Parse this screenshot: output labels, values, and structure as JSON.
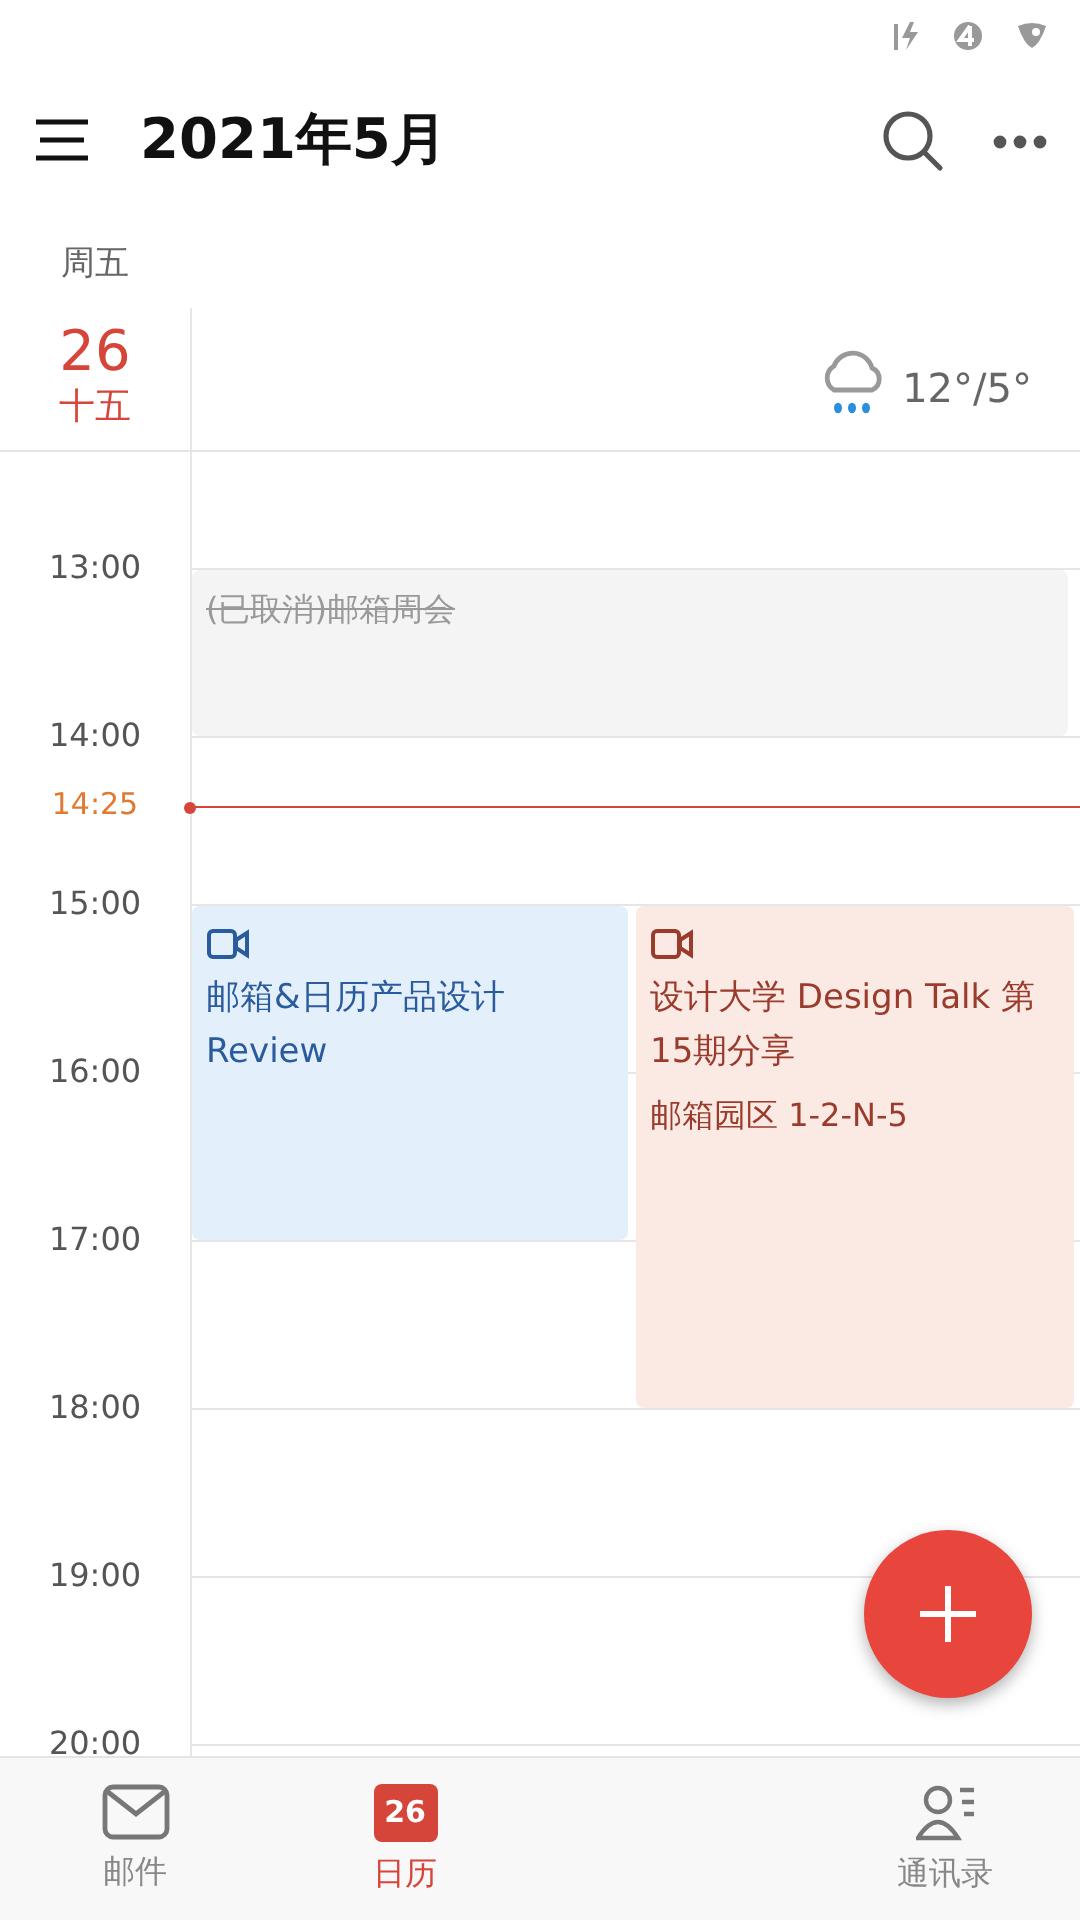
{
  "header": {
    "title": "2021年5月"
  },
  "day": {
    "weekday": "周五",
    "date": "26",
    "lunar": "十五",
    "weather": "12°/5°"
  },
  "hours": [
    "13:00",
    "14:00",
    "15:00",
    "16:00",
    "17:00",
    "18:00",
    "19:00",
    "20:00"
  ],
  "now": {
    "label": "14:25"
  },
  "events": [
    {
      "title": "(已取消)邮箱周会",
      "cancelled": true,
      "video": false,
      "color": "#f4f4f4"
    },
    {
      "title": "邮箱&日历产品设计Review",
      "cancelled": false,
      "video": true,
      "color": "#e4effc"
    },
    {
      "title": "设计大学 Design Talk 第15期分享",
      "location": "邮箱园区 1-2-N-5",
      "cancelled": false,
      "video": true,
      "color": "#fbe9e4"
    }
  ],
  "tabs": [
    {
      "label": "邮件",
      "kind": "mail",
      "selected": false
    },
    {
      "label": "日历",
      "kind": "calendar",
      "badge": "26",
      "selected": true
    },
    {
      "label": "通讯录",
      "kind": "contacts",
      "selected": false
    }
  ]
}
